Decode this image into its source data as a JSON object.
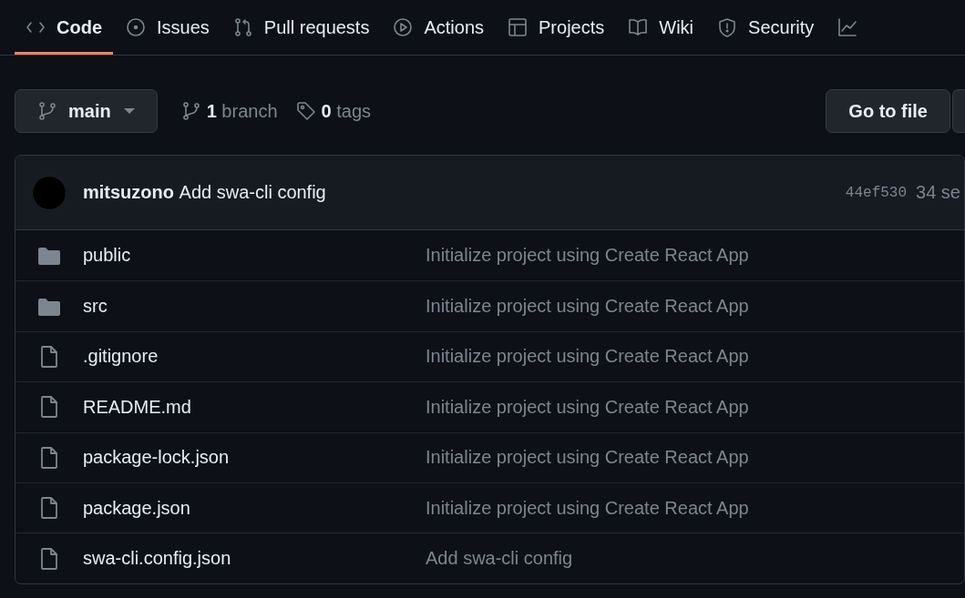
{
  "tabs": [
    {
      "label": "Code",
      "selected": true
    },
    {
      "label": "Issues",
      "selected": false
    },
    {
      "label": "Pull requests",
      "selected": false
    },
    {
      "label": "Actions",
      "selected": false
    },
    {
      "label": "Projects",
      "selected": false
    },
    {
      "label": "Wiki",
      "selected": false
    },
    {
      "label": "Security",
      "selected": false
    },
    {
      "selected": false
    }
  ],
  "branch_selector": {
    "label": "main"
  },
  "branch_count": {
    "count": "1",
    "label": "branch"
  },
  "tag_count": {
    "count": "0",
    "label": "tags"
  },
  "go_to_file_button": "Go to file",
  "latest_commit": {
    "author": "mitsuzono",
    "message": "Add swa-cli config",
    "hash": "44ef530",
    "time": "34 se"
  },
  "files": [
    {
      "kind": "folder",
      "name": "public",
      "message": "Initialize project using Create React App"
    },
    {
      "kind": "folder",
      "name": "src",
      "message": "Initialize project using Create React App"
    },
    {
      "kind": "file",
      "name": ".gitignore",
      "message": "Initialize project using Create React App"
    },
    {
      "kind": "file",
      "name": "README.md",
      "message": "Initialize project using Create React App"
    },
    {
      "kind": "file",
      "name": "package-lock.json",
      "message": "Initialize project using Create React App"
    },
    {
      "kind": "file",
      "name": "package.json",
      "message": "Initialize project using Create React App"
    },
    {
      "kind": "file",
      "name": "swa-cli.config.json",
      "message": "Add swa-cli config"
    }
  ]
}
